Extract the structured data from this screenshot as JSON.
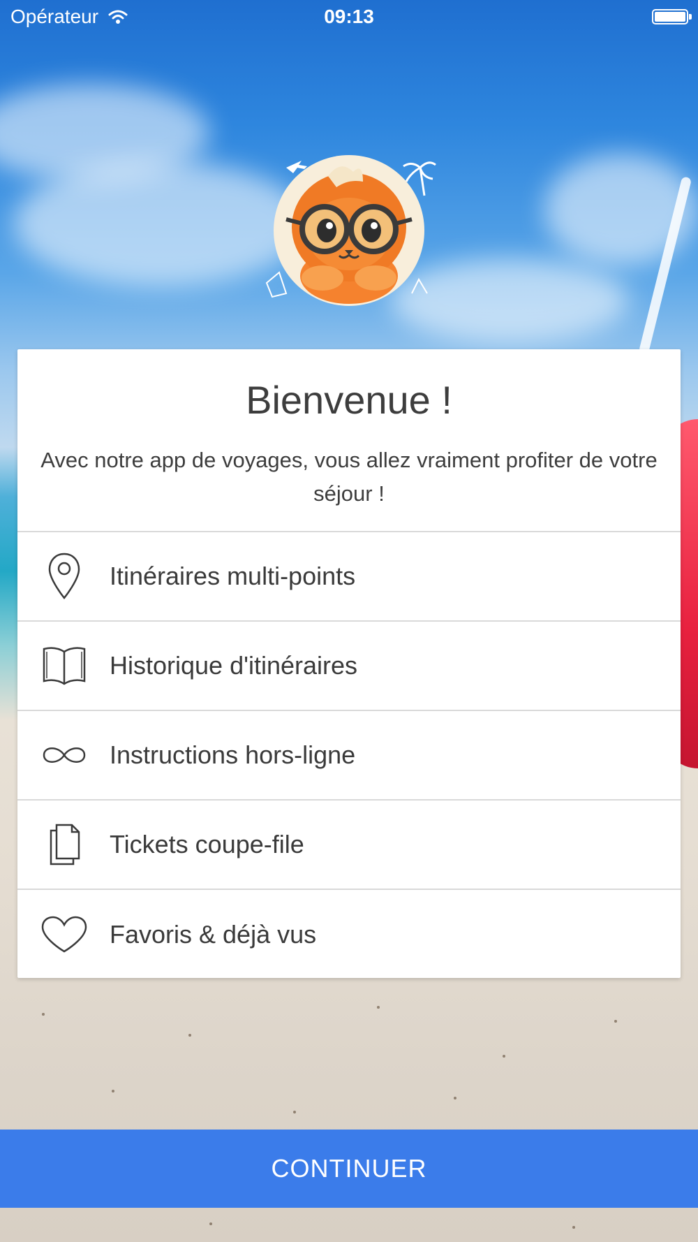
{
  "status_bar": {
    "carrier": "Opérateur",
    "time": "09:13",
    "wifi_icon": "wifi-icon",
    "battery_icon": "battery-icon"
  },
  "mascot": {
    "icon": "lion-mascot-with-glasses"
  },
  "welcome": {
    "title": "Bienvenue !",
    "subtitle": "Avec notre app de voyages, vous allez vraiment profiter de votre séjour !"
  },
  "features": [
    {
      "icon": "map-pin-icon",
      "label": "Itinéraires multi-points"
    },
    {
      "icon": "book-icon",
      "label": "Historique d'itinéraires"
    },
    {
      "icon": "infinity-icon",
      "label": "Instructions hors-ligne"
    },
    {
      "icon": "documents-icon",
      "label": "Tickets coupe-file"
    },
    {
      "icon": "heart-icon",
      "label": "Favoris & déjà vus"
    }
  ],
  "continue_label": "CONTINUER",
  "colors": {
    "accent": "#3b7cea",
    "card_bg": "#ffffff",
    "text": "#3d3d3d"
  }
}
